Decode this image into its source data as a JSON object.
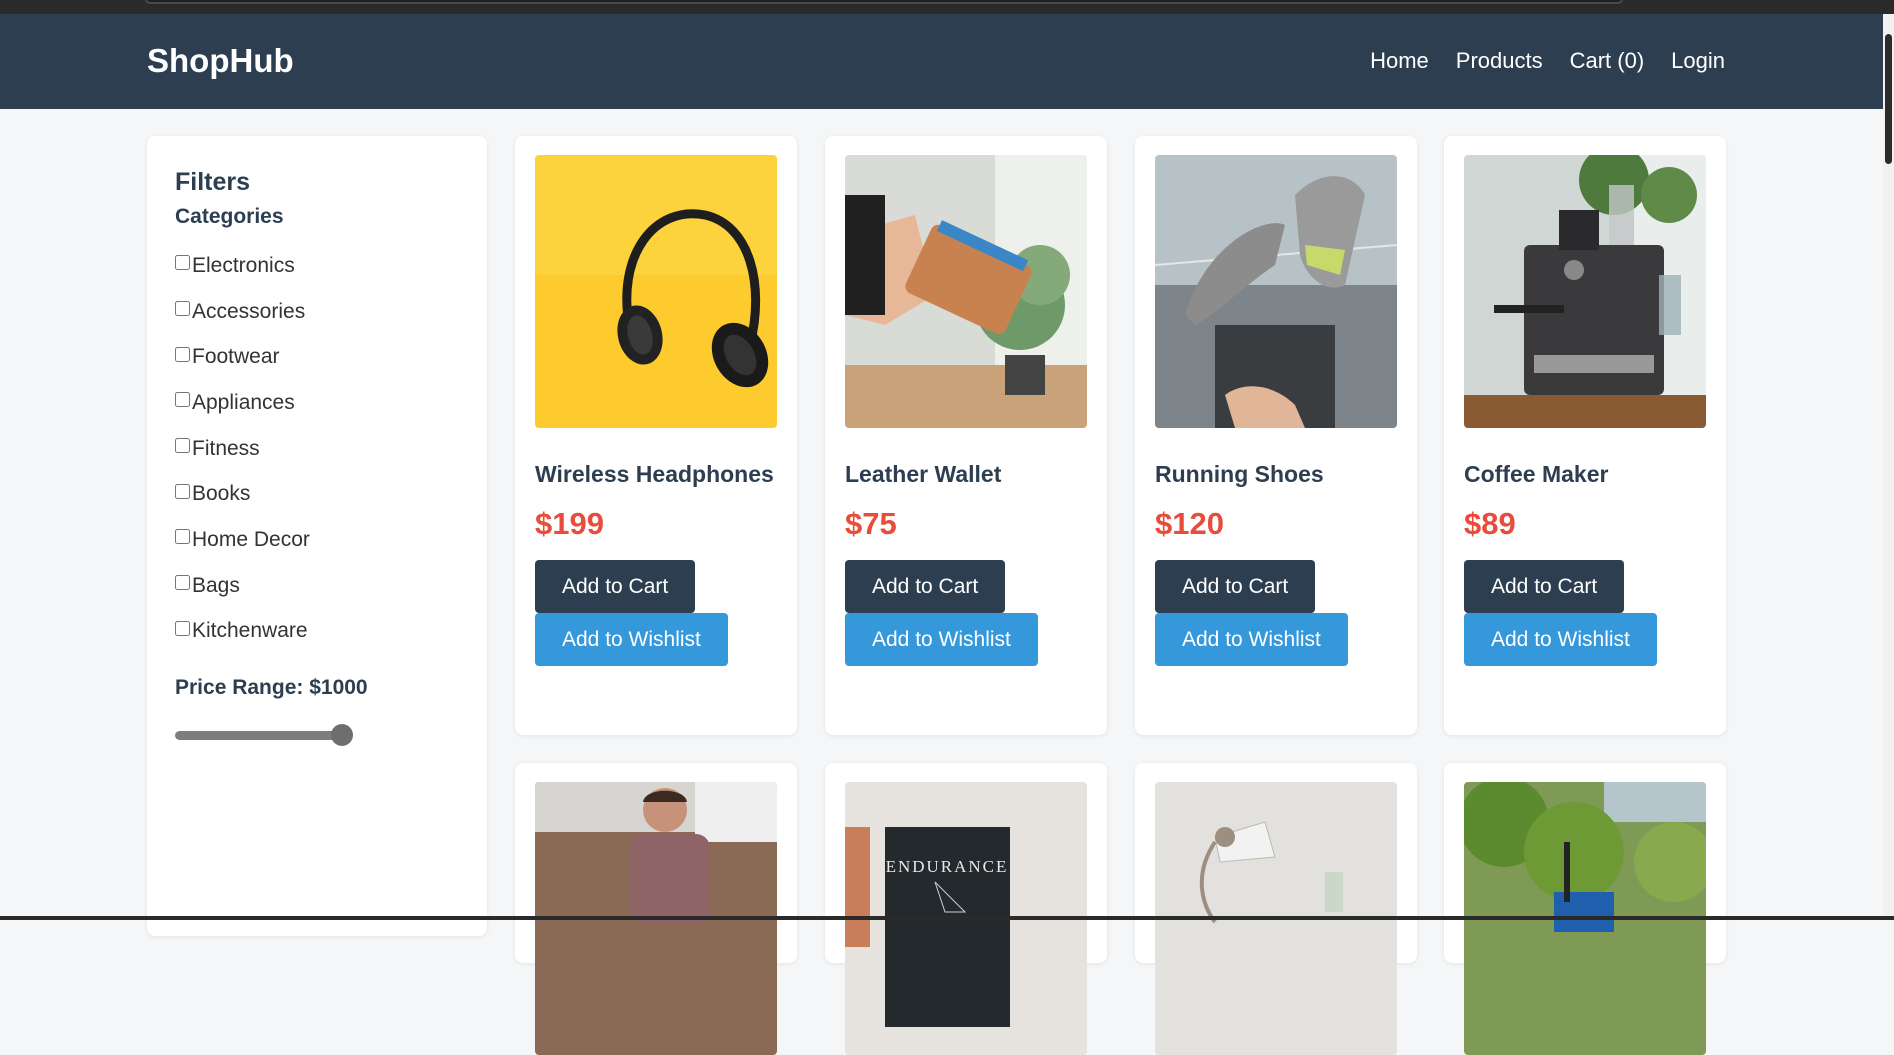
{
  "header": {
    "brand": "ShopHub",
    "nav": [
      "Home",
      "Products",
      "Cart (0)",
      "Login"
    ]
  },
  "filters": {
    "title": "Filters",
    "categories_title": "Categories",
    "categories": [
      "Electronics",
      "Accessories",
      "Footwear",
      "Appliances",
      "Fitness",
      "Books",
      "Home Decor",
      "Bags",
      "Kitchenware"
    ],
    "price_label": "Price Range: $1000",
    "price_slider_fraction": 1.0
  },
  "buttons": {
    "add_to_cart": "Add to Cart",
    "add_to_wishlist": "Add to Wishlist"
  },
  "products": [
    {
      "name": "Wireless Headphones",
      "price": "$199",
      "image": "headphones-photo"
    },
    {
      "name": "Leather Wallet",
      "price": "$75",
      "image": "wallet-photo"
    },
    {
      "name": "Running Shoes",
      "price": "$120",
      "image": "shoes-photo"
    },
    {
      "name": "Coffee Maker",
      "price": "$89",
      "image": "coffee-maker-photo"
    }
  ],
  "products_row2_images": [
    "person-floor-photo",
    "endurance-book-photo",
    "desk-lamp-photo",
    "outdoor-trees-photo"
  ],
  "row2_book_text": "ENDURANCE",
  "colors": {
    "nav_bg": "#2c3e50",
    "price": "#e74c3c",
    "cart_button": "#2c3e50",
    "wishlist_button": "#3498db"
  }
}
